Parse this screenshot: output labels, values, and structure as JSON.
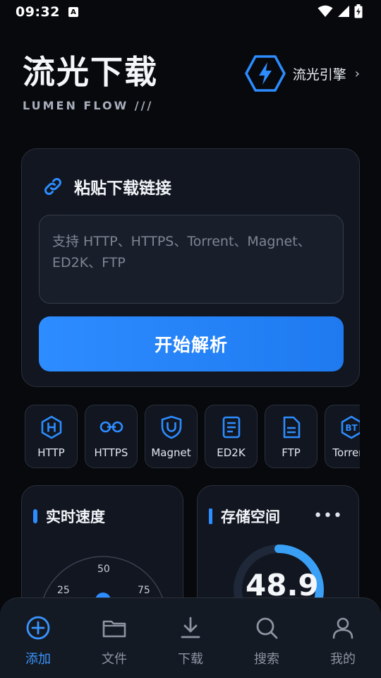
{
  "status_bar": {
    "time": "09:32",
    "badge": "A"
  },
  "header": {
    "title": "流光下载",
    "subtitle": "LUMEN FLOW ///",
    "engine_label": "流光引擎",
    "engine_chevron": "›"
  },
  "paste_card": {
    "title": "粘贴下载链接",
    "placeholder": "支持 HTTP、HTTPS、Torrent、Magnet、ED2K、FTP",
    "button_label": "开始解析"
  },
  "protocols": [
    {
      "label": "HTTP",
      "icon": "h-hexagon-icon"
    },
    {
      "label": "HTTPS",
      "icon": "secure-link-icon"
    },
    {
      "label": "Magnet",
      "icon": "magnet-shield-icon"
    },
    {
      "label": "ED2K",
      "icon": "document-icon"
    },
    {
      "label": "FTP",
      "icon": "file-icon"
    },
    {
      "label": "Torrent",
      "icon": "bt-hexagon-icon"
    }
  ],
  "speed_widget": {
    "title": "实时速度",
    "ticks": [
      "25",
      "50",
      "75"
    ]
  },
  "storage_widget": {
    "title": "存储空间",
    "value": "48.9",
    "more": "•••",
    "fill_fraction": 0.49
  },
  "tabs": [
    {
      "label": "添加",
      "icon": "add-circle-icon",
      "active": true
    },
    {
      "label": "文件",
      "icon": "folder-icon",
      "active": false
    },
    {
      "label": "下载",
      "icon": "download-icon",
      "active": false
    },
    {
      "label": "搜索",
      "icon": "search-icon",
      "active": false
    },
    {
      "label": "我的",
      "icon": "user-icon",
      "active": false
    }
  ],
  "colors": {
    "accent": "#2d8cff",
    "background": "#07090d",
    "card": "#111620"
  }
}
